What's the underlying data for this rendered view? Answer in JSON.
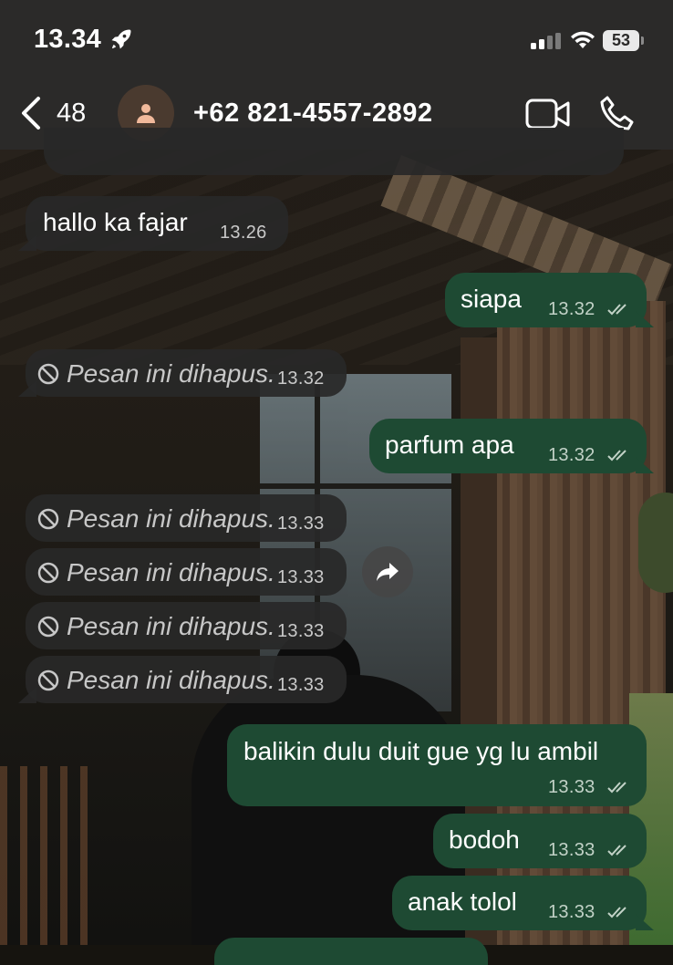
{
  "status": {
    "time": "13.34",
    "battery": "53"
  },
  "header": {
    "back_count": "48",
    "contact": "+62 821-4557-2892"
  },
  "messages": [
    {
      "dir": "in",
      "text": "hallo ka fajar",
      "time": "13.26"
    },
    {
      "dir": "out",
      "text": "siapa",
      "time": "13.32"
    },
    {
      "dir": "in",
      "text": "Pesan ini dihapus.",
      "time": "13.32",
      "deleted": true
    },
    {
      "dir": "out",
      "text": "parfum apa",
      "time": "13.32"
    },
    {
      "dir": "in",
      "text": "Pesan ini dihapus.",
      "time": "13.33",
      "deleted": true
    },
    {
      "dir": "in",
      "text": "Pesan ini dihapus.",
      "time": "13.33",
      "deleted": true
    },
    {
      "dir": "in",
      "text": "Pesan ini dihapus.",
      "time": "13.33",
      "deleted": true
    },
    {
      "dir": "in",
      "text": "Pesan ini dihapus.",
      "time": "13.33",
      "deleted": true
    },
    {
      "dir": "out",
      "text": "balikin dulu duit gue yg lu ambil",
      "time": "13.33"
    },
    {
      "dir": "out",
      "text": "bodoh",
      "time": "13.33"
    },
    {
      "dir": "out",
      "text": "anak tolol",
      "time": "13.33"
    }
  ],
  "icons": {
    "status": [
      "rocket-icon",
      "signal-icon",
      "wifi-icon",
      "battery-icon"
    ],
    "header": [
      "chevron-left-icon",
      "person-icon",
      "video-call-icon",
      "phone-icon"
    ],
    "chat": [
      "deleted-ban-icon",
      "double-check-icon",
      "forward-icon"
    ]
  },
  "colors": {
    "bar": "#2b2a29",
    "incoming": "#282828",
    "outgoing": "#1e4a33"
  }
}
